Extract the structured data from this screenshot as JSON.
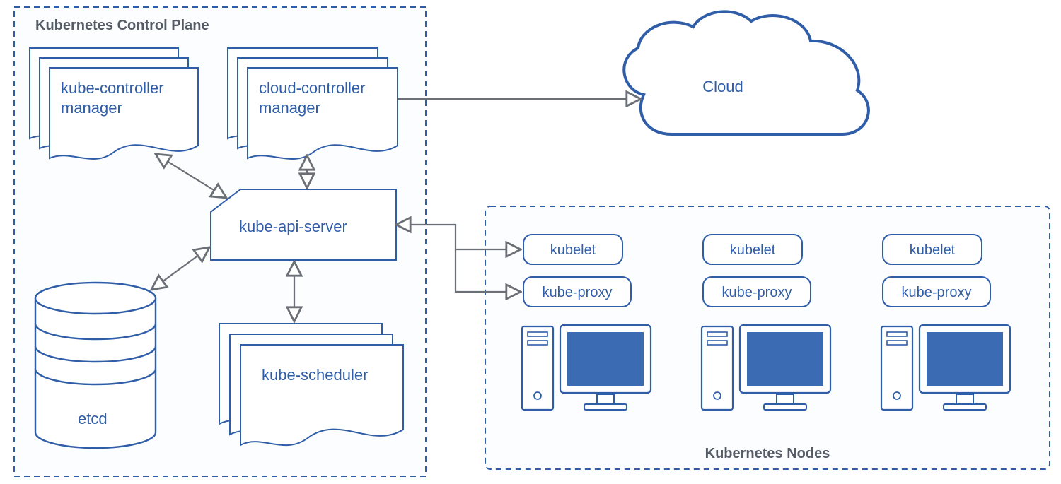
{
  "diagram": {
    "controlPlane": {
      "title": "Kubernetes Control Plane",
      "components": {
        "kubeControllerManager": {
          "line1": "kube-controller",
          "line2": "manager"
        },
        "cloudControllerManager": {
          "line1": "cloud-controller",
          "line2": "manager"
        },
        "apiServer": "kube-api-server",
        "scheduler": "kube-scheduler",
        "etcd": "etcd"
      }
    },
    "nodesPanel": {
      "title": "Kubernetes Nodes",
      "nodes": [
        {
          "kubelet": "kubelet",
          "kubeProxy": "kube-proxy"
        },
        {
          "kubelet": "kubelet",
          "kubeProxy": "kube-proxy"
        },
        {
          "kubelet": "kubelet",
          "kubeProxy": "kube-proxy"
        }
      ]
    },
    "cloud": {
      "label": "Cloud"
    },
    "colors": {
      "blueStroke": "#2f5da8",
      "blueFill": "#3a6bb3",
      "greyArrow": "#6b6f76",
      "greyText": "#555c66"
    }
  }
}
